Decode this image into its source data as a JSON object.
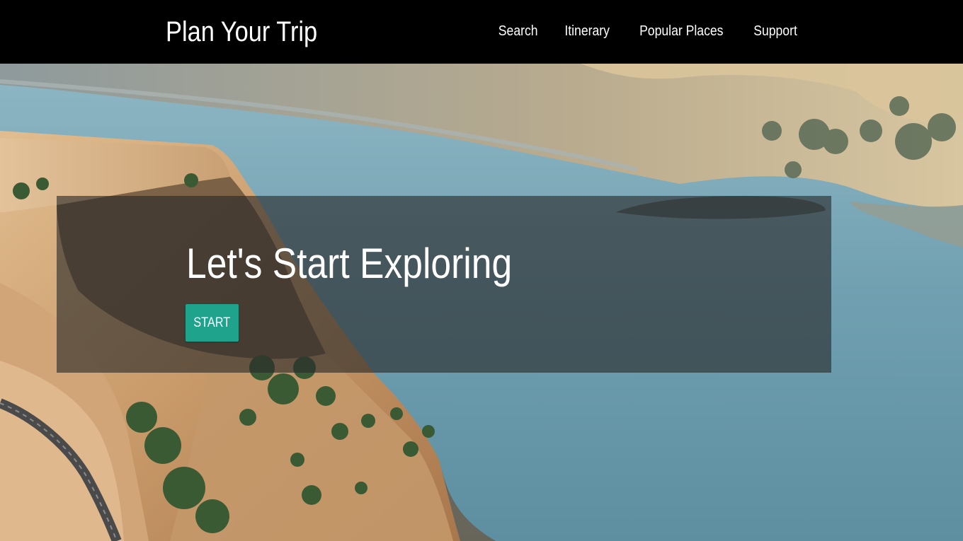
{
  "header": {
    "brand": "Plan Your Trip",
    "nav": [
      {
        "label": "Search"
      },
      {
        "label": "Itinerary"
      },
      {
        "label": "Popular Places"
      },
      {
        "label": "Support"
      }
    ]
  },
  "hero": {
    "headline": "Let's Start Exploring",
    "start_label": "START",
    "background": "aerial river canyon landscape"
  },
  "colors": {
    "navbar_bg": "#000000",
    "accent": "#1fa38d",
    "overlay": "rgba(40,40,40,0.62)",
    "water": "#7fa9b8",
    "cliff": "#c49a6c"
  }
}
